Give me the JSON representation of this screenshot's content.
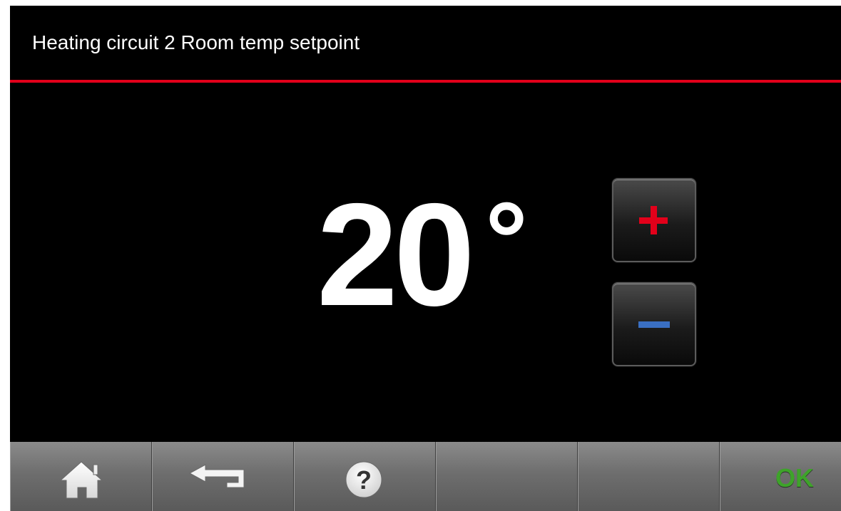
{
  "header": {
    "title": "Heating circuit 2 Room temp setpoint"
  },
  "setpoint": {
    "value": "20",
    "unit": "°"
  },
  "controls": {
    "increase_icon": "plus-icon",
    "decrease_icon": "minus-icon"
  },
  "nav": {
    "home_icon": "home-icon",
    "back_icon": "back-arrow-icon",
    "help_icon": "help-icon",
    "ok_label": "OK"
  },
  "colors": {
    "accent_red": "#e2001a",
    "minus_blue": "#3a6fc2",
    "ok_green": "#3ea32a",
    "background": "#000000"
  }
}
